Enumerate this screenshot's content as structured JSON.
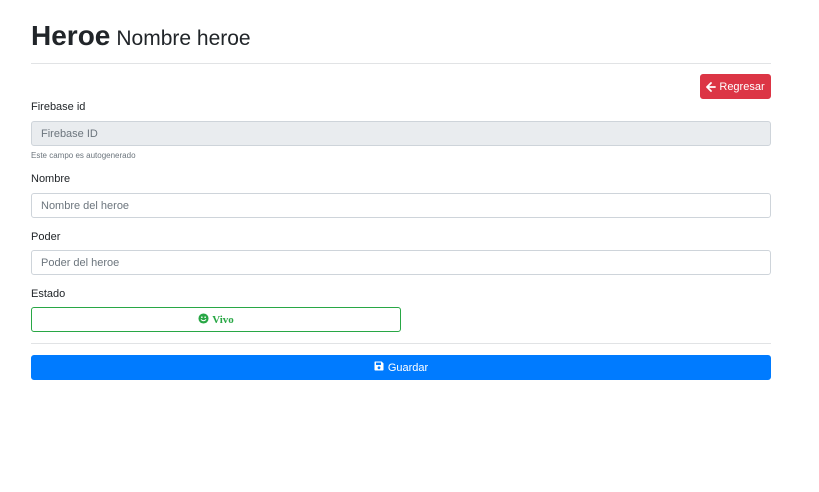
{
  "header": {
    "title": "Heroe",
    "subtitle": "Nombre heroe"
  },
  "actions": {
    "back_label": "Regresar",
    "back_icon": "arrow-left-icon",
    "save_label": "Guardar",
    "save_icon": "save-icon"
  },
  "form": {
    "firebase": {
      "label": "Firebase id",
      "placeholder": "Firebase ID",
      "value": "",
      "help": "Este campo es autogenerado"
    },
    "nombre": {
      "label": "Nombre",
      "placeholder": "Nombre del heroe",
      "value": ""
    },
    "poder": {
      "label": "Poder",
      "placeholder": "Poder del heroe",
      "value": ""
    },
    "estado": {
      "label": "Estado",
      "value_label": "Vivo",
      "icon": "smile-icon"
    }
  },
  "colors": {
    "danger": "#dc3545",
    "primary": "#007bff",
    "success": "#28a745",
    "readonly_bg": "#e9ecef"
  }
}
